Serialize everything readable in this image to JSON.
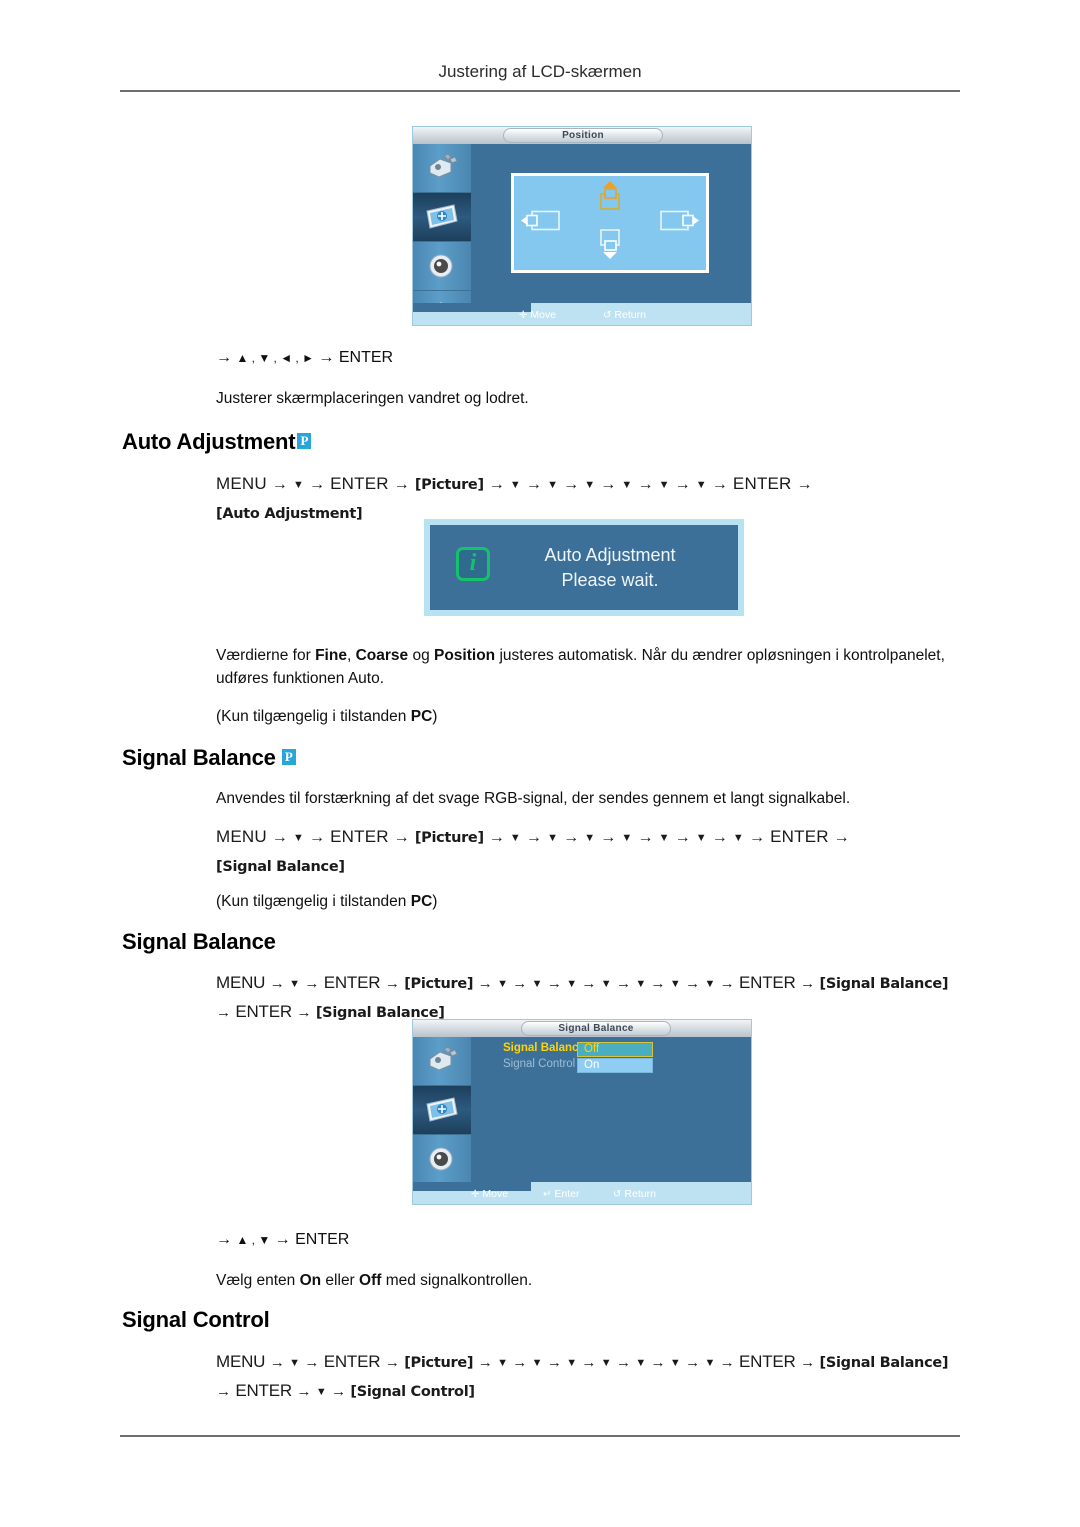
{
  "document": {
    "header_title": "Justering af LCD-skærmen"
  },
  "osd_position": {
    "title": "Position",
    "footer": [
      {
        "icon": "move-icon",
        "glyph": "✛",
        "label": "Move"
      },
      {
        "icon": "return-icon",
        "glyph": "↺",
        "label": "Return"
      }
    ],
    "sidebar_icons": [
      "input-plug-icon",
      "picture-icon",
      "sound-speaker-icon",
      "setup-gear-icon",
      "multi-control-icon"
    ],
    "selected_sidebar_index": 1
  },
  "position_section": {
    "nav_prefix": "→",
    "nav_keys": "▲ , ▼ , ◄ , ►",
    "nav_arrow": "→",
    "nav_enter": "ENTER",
    "description": "Justerer skærmplaceringen vandret og lodret."
  },
  "auto_adjustment": {
    "heading": "Auto Adjustment",
    "badge": "P",
    "path_line1": [
      {
        "t": "MENU",
        "k": "text"
      },
      {
        "t": "→",
        "k": "arr"
      },
      {
        "t": "▼",
        "k": "dn"
      },
      {
        "t": "→",
        "k": "arr"
      },
      {
        "t": "ENTER",
        "k": "text"
      },
      {
        "t": "→",
        "k": "arr"
      },
      {
        "t": "[Picture]",
        "k": "tok"
      },
      {
        "t": "→",
        "k": "arr"
      },
      {
        "t": "▼",
        "k": "dn"
      },
      {
        "t": "→",
        "k": "arr"
      },
      {
        "t": "▼",
        "k": "dn"
      },
      {
        "t": "→",
        "k": "arr"
      },
      {
        "t": "▼",
        "k": "dn"
      },
      {
        "t": "→",
        "k": "arr"
      },
      {
        "t": "▼",
        "k": "dn"
      },
      {
        "t": "→",
        "k": "arr"
      },
      {
        "t": "▼",
        "k": "dn"
      },
      {
        "t": "→",
        "k": "arr"
      },
      {
        "t": "▼",
        "k": "dn"
      },
      {
        "t": "→",
        "k": "arr"
      },
      {
        "t": "ENTER",
        "k": "text"
      },
      {
        "t": "→",
        "k": "arr"
      }
    ],
    "path_line2": "[Auto Adjustment]",
    "dialog": {
      "icon": "info-icon",
      "icon_glyph": "i",
      "line1": "Auto Adjustment",
      "line2": "Please wait."
    },
    "description_parts": [
      {
        "t": "Værdierne for ",
        "b": false
      },
      {
        "t": "Fine",
        "b": true
      },
      {
        "t": ", ",
        "b": false
      },
      {
        "t": "Coarse",
        "b": true
      },
      {
        "t": " og ",
        "b": false
      },
      {
        "t": "Position",
        "b": true
      },
      {
        "t": " justeres automatisk. Når du ændrer opløsningen i kontrolpanelet, udføres funktionen Auto.",
        "b": false
      }
    ],
    "availability_parts": [
      {
        "t": "(Kun tilgængelig i tilstanden ",
        "b": false
      },
      {
        "t": "PC",
        "b": true
      },
      {
        "t": ")",
        "b": false
      }
    ]
  },
  "signal_balance_1": {
    "heading": "Signal Balance",
    "badge": "P",
    "description": "Anvendes til forstærkning af det svage RGB-signal, der sendes gennem et langt signalkabel.",
    "path_line1": [
      {
        "t": "MENU",
        "k": "text"
      },
      {
        "t": "→",
        "k": "arr"
      },
      {
        "t": "▼",
        "k": "dn"
      },
      {
        "t": "→",
        "k": "arr"
      },
      {
        "t": "ENTER",
        "k": "text"
      },
      {
        "t": "→",
        "k": "arr"
      },
      {
        "t": "[Picture]",
        "k": "tok"
      },
      {
        "t": "→",
        "k": "arr"
      },
      {
        "t": "▼",
        "k": "dn"
      },
      {
        "t": "→",
        "k": "arr"
      },
      {
        "t": "▼",
        "k": "dn"
      },
      {
        "t": "→",
        "k": "arr"
      },
      {
        "t": "▼",
        "k": "dn"
      },
      {
        "t": "→",
        "k": "arr"
      },
      {
        "t": "▼",
        "k": "dn"
      },
      {
        "t": "→",
        "k": "arr"
      },
      {
        "t": "▼",
        "k": "dn"
      },
      {
        "t": "→",
        "k": "arr"
      },
      {
        "t": "▼",
        "k": "dn"
      },
      {
        "t": "→",
        "k": "arr"
      },
      {
        "t": "▼",
        "k": "dn"
      },
      {
        "t": "→",
        "k": "arr"
      },
      {
        "t": "ENTER",
        "k": "text"
      },
      {
        "t": "→",
        "k": "arr"
      }
    ],
    "path_line2": "[Signal Balance]",
    "availability_parts": [
      {
        "t": "(Kun tilgængelig i tilstanden ",
        "b": false
      },
      {
        "t": "PC",
        "b": true
      },
      {
        "t": ")",
        "b": false
      }
    ]
  },
  "signal_balance_2": {
    "heading": "Signal Balance",
    "path_line1": [
      {
        "t": "MENU",
        "k": "text"
      },
      {
        "t": "→",
        "k": "arr"
      },
      {
        "t": "▼",
        "k": "dn"
      },
      {
        "t": "→",
        "k": "arr"
      },
      {
        "t": "ENTER",
        "k": "text"
      },
      {
        "t": "→",
        "k": "arr"
      },
      {
        "t": "[Picture]",
        "k": "tok"
      },
      {
        "t": "→",
        "k": "arr"
      },
      {
        "t": "▼",
        "k": "dn"
      },
      {
        "t": "→",
        "k": "arr"
      },
      {
        "t": "▼",
        "k": "dn"
      },
      {
        "t": "→",
        "k": "arr"
      },
      {
        "t": "▼",
        "k": "dn"
      },
      {
        "t": "→",
        "k": "arr"
      },
      {
        "t": "▼",
        "k": "dn"
      },
      {
        "t": "→",
        "k": "arr"
      },
      {
        "t": "▼",
        "k": "dn"
      },
      {
        "t": "→",
        "k": "arr"
      },
      {
        "t": "▼",
        "k": "dn"
      },
      {
        "t": "→",
        "k": "arr"
      },
      {
        "t": "▼",
        "k": "dn"
      },
      {
        "t": "→",
        "k": "arr"
      },
      {
        "t": "ENTER",
        "k": "text"
      },
      {
        "t": "→",
        "k": "arr"
      },
      {
        "t": "[Signal Balance]",
        "k": "tok"
      }
    ],
    "path_line2": [
      {
        "t": "→",
        "k": "arr"
      },
      {
        "t": "ENTER",
        "k": "text"
      },
      {
        "t": "→",
        "k": "arr"
      },
      {
        "t": "[Signal Balance]",
        "k": "tok"
      }
    ],
    "osd": {
      "title": "Signal Balance",
      "rows": [
        {
          "label": "Signal Balance",
          "state": "active",
          "colon": ":"
        },
        {
          "label": "Signal Control",
          "state": "dim",
          "colon": ""
        }
      ],
      "options": [
        {
          "label": "Off",
          "selected": true
        },
        {
          "label": "On",
          "selected": false
        }
      ],
      "footer": [
        {
          "icon": "move-icon",
          "glyph": "✛",
          "label": "Move"
        },
        {
          "icon": "enter-icon",
          "glyph": "↵",
          "label": "Enter"
        },
        {
          "icon": "return-icon",
          "glyph": "↺",
          "label": "Return"
        }
      ],
      "sidebar_icons": [
        "input-plug-icon",
        "picture-icon",
        "sound-speaker-icon",
        "setup-gear-icon",
        "multi-control-icon"
      ],
      "selected_sidebar_index": 1
    },
    "nav_prefix": "→",
    "nav_keys": "▲ , ▼",
    "nav_arrow": "→",
    "nav_enter": "ENTER",
    "description_parts": [
      {
        "t": "Vælg enten ",
        "b": false
      },
      {
        "t": "On",
        "b": true
      },
      {
        "t": " eller ",
        "b": false
      },
      {
        "t": "Off",
        "b": true
      },
      {
        "t": " med signalkontrollen.",
        "b": false
      }
    ]
  },
  "signal_control": {
    "heading": "Signal Control",
    "path_line1": [
      {
        "t": "MENU",
        "k": "text"
      },
      {
        "t": "→",
        "k": "arr"
      },
      {
        "t": "▼",
        "k": "dn"
      },
      {
        "t": "→",
        "k": "arr"
      },
      {
        "t": "ENTER",
        "k": "text"
      },
      {
        "t": "→",
        "k": "arr"
      },
      {
        "t": "[Picture]",
        "k": "tok"
      },
      {
        "t": "→",
        "k": "arr"
      },
      {
        "t": "▼",
        "k": "dn"
      },
      {
        "t": "→",
        "k": "arr"
      },
      {
        "t": "▼",
        "k": "dn"
      },
      {
        "t": "→",
        "k": "arr"
      },
      {
        "t": "▼",
        "k": "dn"
      },
      {
        "t": "→",
        "k": "arr"
      },
      {
        "t": "▼",
        "k": "dn"
      },
      {
        "t": "→",
        "k": "arr"
      },
      {
        "t": "▼",
        "k": "dn"
      },
      {
        "t": "→",
        "k": "arr"
      },
      {
        "t": "▼",
        "k": "dn"
      },
      {
        "t": "→",
        "k": "arr"
      },
      {
        "t": "▼",
        "k": "dn"
      },
      {
        "t": "→",
        "k": "arr"
      },
      {
        "t": "ENTER",
        "k": "text"
      },
      {
        "t": "→",
        "k": "arr"
      },
      {
        "t": "[Signal Balance]",
        "k": "tok"
      }
    ],
    "path_line2": [
      {
        "t": "→",
        "k": "arr"
      },
      {
        "t": "ENTER",
        "k": "text"
      },
      {
        "t": "→",
        "k": "arr"
      },
      {
        "t": "▼",
        "k": "dn"
      },
      {
        "t": "→",
        "k": "arr"
      },
      {
        "t": "[Signal Control]",
        "k": "tok"
      }
    ]
  },
  "colors": {
    "osd_background": "#3d7099",
    "osd_sidebar": "#5b9ec9",
    "osd_footer": "#bfe2f2",
    "position_box": "#84c8ef",
    "badge_blue": "#2aa5d8",
    "highlight_yellow": "#ffd400",
    "info_green": "#14c26a",
    "option_off_bg": "#4aaec0",
    "option_on_bg": "#8fcdf2"
  }
}
